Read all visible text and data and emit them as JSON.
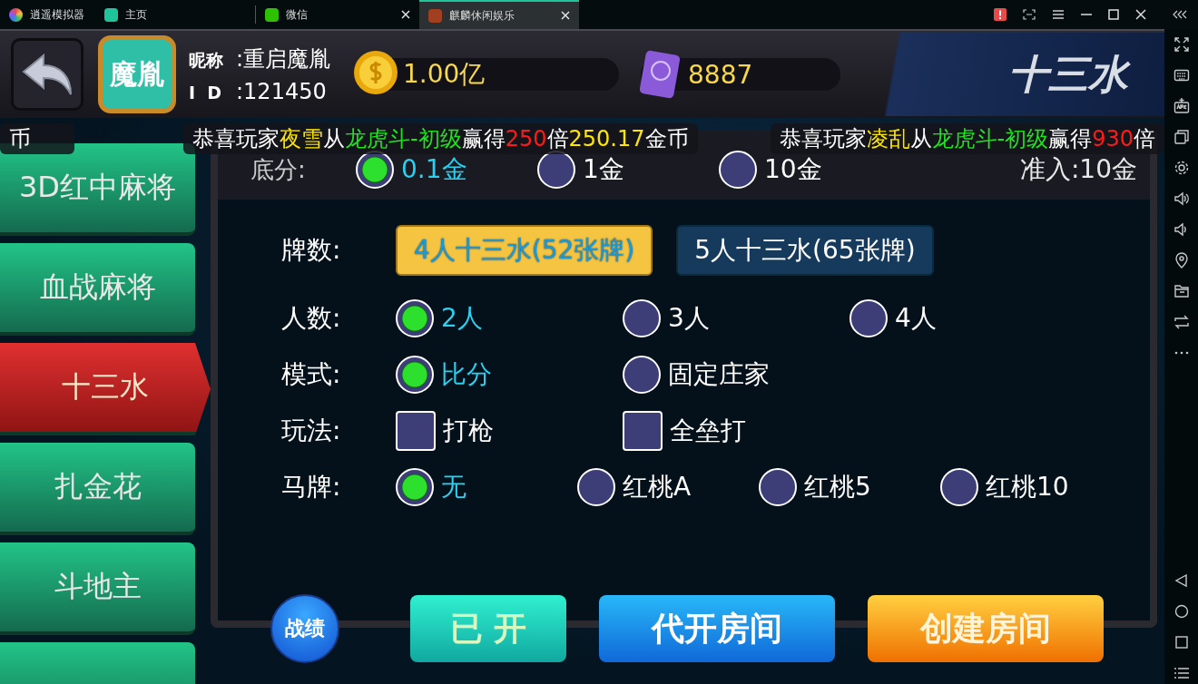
{
  "emulator_tabs": [
    {
      "label": "逍遥模拟器",
      "selected": false,
      "closable": false
    },
    {
      "label": "主页",
      "selected": false,
      "closable": false
    },
    {
      "label": "微信",
      "selected": false,
      "closable": true
    },
    {
      "label": "麒麟休闲娱乐",
      "selected": true,
      "closable": true
    }
  ],
  "header": {
    "avatar_text": "魔胤",
    "nickname_label": "昵称",
    "nickname": ":重启魔胤",
    "id_label": "I  D",
    "id": ":121450",
    "coins": "1.00亿",
    "room_cards": "8887",
    "game_title": "十三水"
  },
  "ticker": [
    {
      "segments": [
        {
          "text": "币",
          "kind": "plain"
        }
      ]
    },
    {
      "segments": [
        {
          "text": "恭喜玩家",
          "kind": "plain"
        },
        {
          "text": "夜雪",
          "kind": "player"
        },
        {
          "text": "从",
          "kind": "plain"
        },
        {
          "text": "龙虎斗-初级",
          "kind": "game"
        },
        {
          "text": "赢得",
          "kind": "plain"
        },
        {
          "text": "250",
          "kind": "multiplier"
        },
        {
          "text": "倍",
          "kind": "plain"
        },
        {
          "text": "250.17",
          "kind": "player"
        },
        {
          "text": "金币",
          "kind": "plain"
        }
      ]
    },
    {
      "segments": [
        {
          "text": "恭喜玩家",
          "kind": "plain"
        },
        {
          "text": "凌乱",
          "kind": "player"
        },
        {
          "text": "从",
          "kind": "plain"
        },
        {
          "text": "龙虎斗-初级",
          "kind": "game"
        },
        {
          "text": "赢得",
          "kind": "plain"
        },
        {
          "text": "930",
          "kind": "multiplier"
        },
        {
          "text": "倍",
          "kind": "plain"
        }
      ]
    }
  ],
  "sidebar": {
    "items": [
      {
        "label": "3D红中麻将",
        "selected": false
      },
      {
        "label": "血战麻将",
        "selected": false
      },
      {
        "label": "十三水",
        "selected": true
      },
      {
        "label": "扎金花",
        "selected": false
      },
      {
        "label": "斗地主",
        "selected": false
      }
    ]
  },
  "base_score": {
    "label": "底分:",
    "options": [
      {
        "label": "0.1金",
        "selected": true
      },
      {
        "label": "1金",
        "selected": false
      },
      {
        "label": "10金",
        "selected": false
      }
    ],
    "entry": "准入:10金"
  },
  "settings": [
    {
      "label": "牌数:",
      "kind": "pill",
      "options": [
        {
          "label": "4人十三水(52张牌)",
          "selected": true
        },
        {
          "label": "5人十三水(65张牌)",
          "selected": false
        }
      ]
    },
    {
      "label": "人数:",
      "kind": "radio",
      "options": [
        {
          "label": "2人",
          "selected": true
        },
        {
          "label": "3人",
          "selected": false
        },
        {
          "label": "4人",
          "selected": false
        }
      ]
    },
    {
      "label": "模式:",
      "kind": "radio",
      "options": [
        {
          "label": "比分",
          "selected": true
        },
        {
          "label": "固定庄家",
          "selected": false
        }
      ]
    },
    {
      "label": "玩法:",
      "kind": "checkbox",
      "options": [
        {
          "label": "打枪",
          "checked": false
        },
        {
          "label": "全垒打",
          "checked": false
        }
      ]
    },
    {
      "label": "马牌:",
      "kind": "radio",
      "options": [
        {
          "label": "无",
          "selected": true
        },
        {
          "label": "红桃A",
          "selected": false
        },
        {
          "label": "红桃5",
          "selected": false
        },
        {
          "label": "红桃10",
          "selected": false
        }
      ]
    }
  ],
  "buttons": [
    {
      "label": "战绩",
      "kind": "round"
    },
    {
      "label": "已 开",
      "kind": "teal"
    },
    {
      "label": "代开房间",
      "kind": "blue"
    },
    {
      "label": "创建房间",
      "kind": "orange"
    }
  ]
}
